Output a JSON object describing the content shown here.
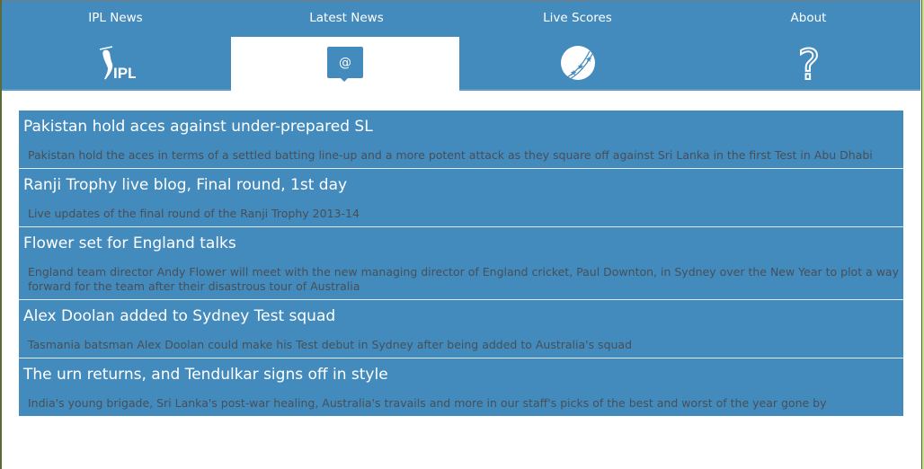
{
  "nav": {
    "tabs": [
      {
        "label": "IPL News",
        "icon": "ipl-logo-icon",
        "selected": false
      },
      {
        "label": "Latest News",
        "icon": "at-chat-bubble-icon",
        "selected": true
      },
      {
        "label": "Live Scores",
        "icon": "cricket-ball-icon",
        "selected": false
      },
      {
        "label": "About",
        "icon": "question-mark-icon",
        "selected": false
      }
    ]
  },
  "icons": {
    "ipl_logo_text": "IPL",
    "at_symbol": "@",
    "question_mark": "?"
  },
  "colors": {
    "primary": "#448bbd",
    "selected_tab_bg": "#ffffff",
    "title_text": "#ffffff",
    "desc_text": "#474f57"
  },
  "news": {
    "items": [
      {
        "title": "Pakistan hold aces against under-prepared SL",
        "description": "Pakistan hold the aces in terms of a settled batting line-up and a more potent attack as they square off against Sri Lanka in the first Test in Abu Dhabi"
      },
      {
        "title": "Ranji Trophy live blog, Final round, 1st day",
        "description": "Live updates of the final round of the Ranji Trophy 2013-14"
      },
      {
        "title": "Flower set for England talks",
        "description": "England team director Andy Flower will meet with the new managing director of England cricket, Paul Downton, in Sydney over the New Year to plot a way forward for the team after their disastrous tour of Australia"
      },
      {
        "title": "Alex Doolan added to Sydney Test squad",
        "description": "Tasmania batsman Alex Doolan could make his Test debut in Sydney after being added to Australia's squad"
      },
      {
        "title": "The urn returns, and Tendulkar signs off in style",
        "description": "India's young brigade, Sri Lanka's post-war healing, Australia's travails and more in our staff's picks of the best and worst of the year gone by"
      }
    ]
  }
}
